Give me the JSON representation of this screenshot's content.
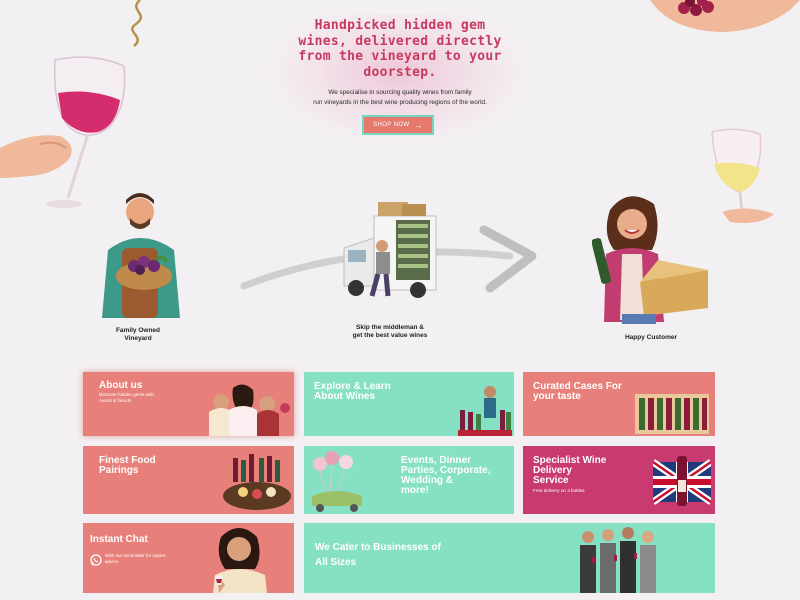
{
  "hero": {
    "title_line1": "Handpicked hidden gem",
    "title_line2": "wines, delivered directly",
    "title_line3": "from the vineyard to your",
    "title_line4": "doorstep.",
    "subtitle_line1": "We specialise in sourcing quality wines from family",
    "subtitle_line2": "run vineyards in the best wine producing regions of the world.",
    "shop_button": "SHOP NOW",
    "shop_arrow": "→"
  },
  "process": {
    "vineyard_line1": "Family Owned",
    "vineyard_line2": "Vineyard",
    "delivery_line1": "Skip the middleman &",
    "delivery_line2": "get the best value wines",
    "customer": "Happy Customer"
  },
  "tiles": {
    "about": {
      "title": "About us",
      "desc_line1": "Discover hidden gems with",
      "desc_line2": "Avanti & friends"
    },
    "explore": {
      "title_line1": "Explore & Learn",
      "title_line2": "About Wines"
    },
    "curated": {
      "title_line1": "Curated Cases For",
      "title_line2": "your taste"
    },
    "food": {
      "title_line1": "Finest Food",
      "title_line2": "Pairings"
    },
    "events": {
      "line1": "Events, Dinner",
      "line2": "Parties, Corporate,",
      "line3": "Wedding &",
      "line4": "more!"
    },
    "specialist": {
      "title_line1": "Specialist Wine",
      "title_line2": "Delivery",
      "title_line3": "Service",
      "desc": "Free delivery on 3 bottles"
    },
    "chat": {
      "title": "Instant Chat",
      "desc_line1": "With our sommelier for expert",
      "desc_line2": "advice"
    },
    "business": {
      "line1": "We Cater to Businesses of",
      "line2": "All Sizes"
    }
  },
  "colors": {
    "accent_pink": "#c8395f",
    "coral": "#e7807a",
    "mint": "#86e0c4",
    "berry": "#c83a70"
  },
  "icons": [
    "arrow-right-icon",
    "whatsapp-icon"
  ]
}
